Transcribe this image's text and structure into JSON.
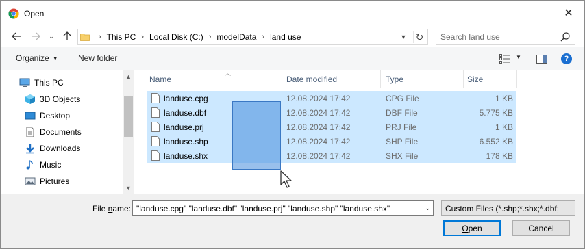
{
  "window": {
    "title": "Open"
  },
  "address": {
    "crumbs": [
      "This PC",
      "Local Disk (C:)",
      "modelData",
      "land use"
    ]
  },
  "search": {
    "placeholder": "Search land use"
  },
  "toolbar": {
    "organize_label": "Organize",
    "new_folder_label": "New folder"
  },
  "navpane": {
    "items": [
      {
        "label": "This PC",
        "icon": "computer-icon"
      },
      {
        "label": "3D Objects",
        "icon": "3d-objects-icon"
      },
      {
        "label": "Desktop",
        "icon": "desktop-icon"
      },
      {
        "label": "Documents",
        "icon": "documents-icon"
      },
      {
        "label": "Downloads",
        "icon": "downloads-icon"
      },
      {
        "label": "Music",
        "icon": "music-icon"
      },
      {
        "label": "Pictures",
        "icon": "pictures-icon"
      }
    ]
  },
  "filelist": {
    "columns": [
      "Name",
      "Date modified",
      "Type",
      "Size"
    ],
    "rows": [
      {
        "name": "landuse.cpg",
        "date": "12.08.2024 17:42",
        "type": "CPG File",
        "size": "1 KB"
      },
      {
        "name": "landuse.dbf",
        "date": "12.08.2024 17:42",
        "type": "DBF File",
        "size": "5.775 KB"
      },
      {
        "name": "landuse.prj",
        "date": "12.08.2024 17:42",
        "type": "PRJ File",
        "size": "1 KB"
      },
      {
        "name": "landuse.shp",
        "date": "12.08.2024 17:42",
        "type": "SHP File",
        "size": "6.552 KB"
      },
      {
        "name": "landuse.shx",
        "date": "12.08.2024 17:42",
        "type": "SHX File",
        "size": "178 KB"
      }
    ]
  },
  "bottom": {
    "file_name_label_pre": "File ",
    "file_name_label_u": "n",
    "file_name_label_post": "ame:",
    "file_name_value": "\"landuse.cpg\" \"landuse.dbf\" \"landuse.prj\" \"landuse.shp\" \"landuse.shx\"",
    "filter_value": "Custom Files (*.shp;*.shx;*.dbf;",
    "open_label_u": "O",
    "open_label_rest": "pen",
    "cancel_label": "Cancel"
  },
  "colors": {
    "selection": "#cce8ff",
    "accent": "#0078d7",
    "marquee": "#468cdc"
  }
}
